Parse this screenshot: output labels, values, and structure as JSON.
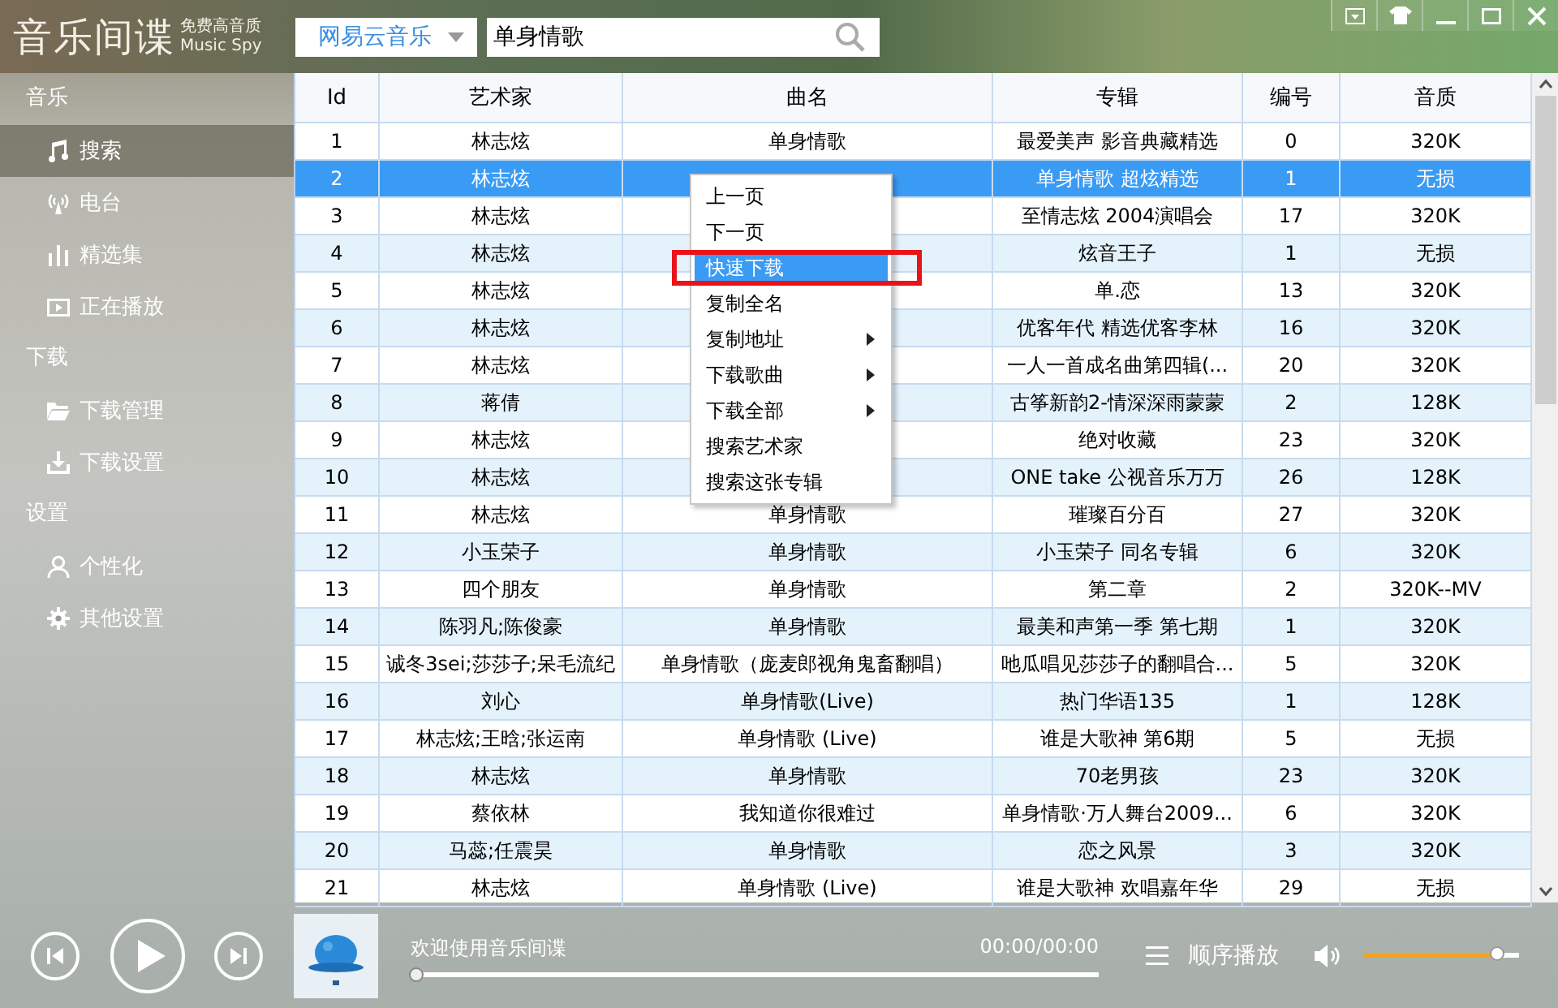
{
  "app": {
    "title": "音乐间谍",
    "tagline": "免费高音质",
    "tagline_en": "Music  Spy"
  },
  "search": {
    "source": "网易云音乐",
    "query": "单身情歌"
  },
  "sidebar": [
    {
      "heading": "音乐",
      "items": [
        {
          "label": "搜索",
          "kind": "music",
          "selected": true
        },
        {
          "label": "电台",
          "kind": "radio",
          "selected": false
        },
        {
          "label": "精选集",
          "kind": "bars",
          "selected": false
        },
        {
          "label": "正在播放",
          "kind": "play",
          "selected": false
        }
      ]
    },
    {
      "heading": "下载",
      "items": [
        {
          "label": "下载管理",
          "kind": "folder",
          "selected": false
        },
        {
          "label": "下载设置",
          "kind": "download",
          "selected": false
        }
      ]
    },
    {
      "heading": "设置",
      "items": [
        {
          "label": "个性化",
          "kind": "user",
          "selected": false
        },
        {
          "label": "其他设置",
          "kind": "gear",
          "selected": false
        }
      ]
    }
  ],
  "table": {
    "columns": [
      "Id",
      "艺术家",
      "曲名",
      "专辑",
      "编号",
      "音质"
    ],
    "rows": [
      {
        "cells": [
          "1",
          "林志炫",
          "单身情歌",
          "最爱美声 影音典藏精选",
          "0",
          "320K"
        ],
        "selected": false
      },
      {
        "cells": [
          "2",
          "林志炫",
          "",
          "单身情歌 超炫精选",
          "1",
          "无损"
        ],
        "selected": true
      },
      {
        "cells": [
          "3",
          "林志炫",
          "",
          "至情志炫 2004演唱会",
          "17",
          "320K"
        ],
        "selected": false
      },
      {
        "cells": [
          "4",
          "林志炫",
          "",
          "炫音王子",
          "1",
          "无损"
        ],
        "selected": false
      },
      {
        "cells": [
          "5",
          "林志炫",
          "",
          "单.恋",
          "13",
          "320K"
        ],
        "selected": false
      },
      {
        "cells": [
          "6",
          "林志炫",
          "",
          "优客年代 精选优客李林",
          "16",
          "320K"
        ],
        "selected": false
      },
      {
        "cells": [
          "7",
          "林志炫",
          "",
          "一人一首成名曲第四辑(...",
          "20",
          "320K"
        ],
        "selected": false
      },
      {
        "cells": [
          "8",
          "蒋倩",
          "",
          "古筝新韵2-情深深雨蒙蒙",
          "2",
          "128K"
        ],
        "selected": false
      },
      {
        "cells": [
          "9",
          "林志炫",
          "",
          "绝对收藏",
          "23",
          "320K"
        ],
        "selected": false
      },
      {
        "cells": [
          "10",
          "林志炫",
          "",
          "ONE take 公视音乐万万",
          "26",
          "128K"
        ],
        "selected": false
      },
      {
        "cells": [
          "11",
          "林志炫",
          "单身情歌",
          "璀璨百分百",
          "27",
          "320K"
        ],
        "selected": false
      },
      {
        "cells": [
          "12",
          "小玉荣子",
          "单身情歌",
          "小玉荣子 同名专辑",
          "6",
          "320K"
        ],
        "selected": false
      },
      {
        "cells": [
          "13",
          "四个朋友",
          "单身情歌",
          "第二章",
          "2",
          "320K--MV"
        ],
        "selected": false
      },
      {
        "cells": [
          "14",
          "陈羽凡;陈俊豪",
          "单身情歌",
          "最美和声第一季 第七期",
          "1",
          "320K"
        ],
        "selected": false
      },
      {
        "cells": [
          "15",
          "诚冬3sei;莎莎子;呆毛流纪",
          "单身情歌（庞麦郎视角鬼畜翻唱）",
          "吔瓜唱见莎莎子的翻唱合...",
          "5",
          "320K"
        ],
        "selected": false
      },
      {
        "cells": [
          "16",
          "刘心",
          "单身情歌(Live)",
          "热门华语135",
          "1",
          "128K"
        ],
        "selected": false
      },
      {
        "cells": [
          "17",
          "林志炫;王晗;张运南",
          "单身情歌 (Live)",
          "谁是大歌神 第6期",
          "5",
          "无损"
        ],
        "selected": false
      },
      {
        "cells": [
          "18",
          "林志炫",
          "单身情歌",
          "70老男孩",
          "23",
          "320K"
        ],
        "selected": false
      },
      {
        "cells": [
          "19",
          "蔡依林",
          "我知道你很难过",
          "单身情歌·万人舞台2009...",
          "6",
          "320K"
        ],
        "selected": false
      },
      {
        "cells": [
          "20",
          "马蕊;任震昊",
          "单身情歌",
          "恋之风景",
          "3",
          "320K"
        ],
        "selected": false
      },
      {
        "cells": [
          "21",
          "林志炫",
          "单身情歌 (Live)",
          "谁是大歌神 欢唱嘉年华",
          "29",
          "无损"
        ],
        "selected": false
      }
    ]
  },
  "context_menu": [
    {
      "label": "上一页",
      "selected": false,
      "submenu": false
    },
    {
      "label": "下一页",
      "selected": false,
      "submenu": false
    },
    {
      "label": "快速下载",
      "selected": true,
      "submenu": false
    },
    {
      "label": "复制全名",
      "selected": false,
      "submenu": false
    },
    {
      "label": "复制地址",
      "selected": false,
      "submenu": true
    },
    {
      "label": "下载歌曲",
      "selected": false,
      "submenu": true
    },
    {
      "label": "下载全部",
      "selected": false,
      "submenu": true
    },
    {
      "label": "搜索艺术家",
      "selected": false,
      "submenu": false
    },
    {
      "label": "搜索这张专辑",
      "selected": false,
      "submenu": false
    }
  ],
  "player": {
    "message": "欢迎使用音乐间谍",
    "time": "00:00/00:00",
    "progress": {
      "level": 0
    },
    "mode": "顺序播放",
    "volume": {
      "level": 0.86
    }
  }
}
